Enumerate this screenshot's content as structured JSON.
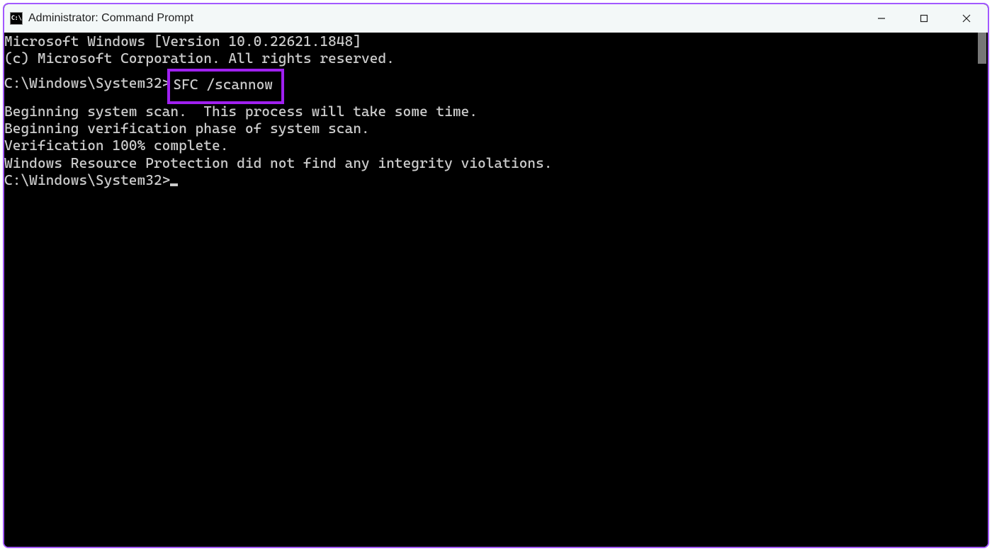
{
  "titlebar": {
    "icon_label": "C:\\",
    "title": "Administrator: Command Prompt"
  },
  "terminal": {
    "line1": "Microsoft Windows [Version 10.0.22621.1848]",
    "line2": "(c) Microsoft Corporation. All rights reserved.",
    "blank1": "",
    "prompt1_prefix": "C:\\Windows\\System32>",
    "prompt1_cmd": "SFC /scannow",
    "blank2": "",
    "line3": "Beginning system scan.  This process will take some time.",
    "blank3": "",
    "line4": "Beginning verification phase of system scan.",
    "line5": "Verification 100% complete.",
    "blank4": "",
    "line6": "Windows Resource Protection did not find any integrity violations.",
    "blank5": "",
    "prompt2": "C:\\Windows\\System32>"
  },
  "highlight_color": "#a020f0",
  "accent_border": "#a259ff"
}
